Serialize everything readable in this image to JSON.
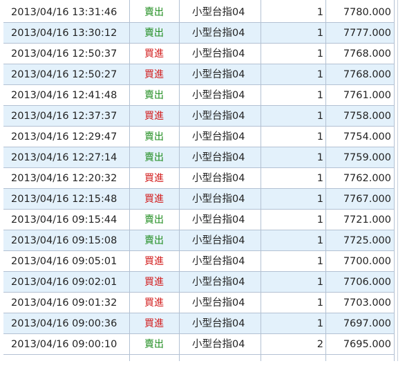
{
  "trades": [
    {
      "time": "2013/04/16 13:31:46",
      "side": "賣出",
      "side_type": "sell",
      "product": "小型台指04",
      "qty": "1",
      "price": "7780.000"
    },
    {
      "time": "2013/04/16 13:30:12",
      "side": "賣出",
      "side_type": "sell",
      "product": "小型台指04",
      "qty": "1",
      "price": "7777.000"
    },
    {
      "time": "2013/04/16 12:50:37",
      "side": "買進",
      "side_type": "buy",
      "product": "小型台指04",
      "qty": "1",
      "price": "7768.000"
    },
    {
      "time": "2013/04/16 12:50:27",
      "side": "買進",
      "side_type": "buy",
      "product": "小型台指04",
      "qty": "1",
      "price": "7768.000"
    },
    {
      "time": "2013/04/16 12:41:48",
      "side": "賣出",
      "side_type": "sell",
      "product": "小型台指04",
      "qty": "1",
      "price": "7761.000"
    },
    {
      "time": "2013/04/16 12:37:37",
      "side": "買進",
      "side_type": "buy",
      "product": "小型台指04",
      "qty": "1",
      "price": "7758.000"
    },
    {
      "time": "2013/04/16 12:29:47",
      "side": "賣出",
      "side_type": "sell",
      "product": "小型台指04",
      "qty": "1",
      "price": "7754.000"
    },
    {
      "time": "2013/04/16 12:27:14",
      "side": "賣出",
      "side_type": "sell",
      "product": "小型台指04",
      "qty": "1",
      "price": "7759.000"
    },
    {
      "time": "2013/04/16 12:20:32",
      "side": "買進",
      "side_type": "buy",
      "product": "小型台指04",
      "qty": "1",
      "price": "7762.000"
    },
    {
      "time": "2013/04/16 12:15:48",
      "side": "買進",
      "side_type": "buy",
      "product": "小型台指04",
      "qty": "1",
      "price": "7767.000"
    },
    {
      "time": "2013/04/16 09:15:44",
      "side": "賣出",
      "side_type": "sell",
      "product": "小型台指04",
      "qty": "1",
      "price": "7721.000"
    },
    {
      "time": "2013/04/16 09:15:08",
      "side": "賣出",
      "side_type": "sell",
      "product": "小型台指04",
      "qty": "1",
      "price": "7725.000"
    },
    {
      "time": "2013/04/16 09:05:01",
      "side": "買進",
      "side_type": "buy",
      "product": "小型台指04",
      "qty": "1",
      "price": "7700.000"
    },
    {
      "time": "2013/04/16 09:02:01",
      "side": "買進",
      "side_type": "buy",
      "product": "小型台指04",
      "qty": "1",
      "price": "7706.000"
    },
    {
      "time": "2013/04/16 09:01:32",
      "side": "買進",
      "side_type": "buy",
      "product": "小型台指04",
      "qty": "1",
      "price": "7703.000"
    },
    {
      "time": "2013/04/16 09:00:36",
      "side": "買進",
      "side_type": "buy",
      "product": "小型台指04",
      "qty": "1",
      "price": "7697.000"
    },
    {
      "time": "2013/04/16 09:00:10",
      "side": "賣出",
      "side_type": "sell",
      "product": "小型台指04",
      "qty": "2",
      "price": "7695.000"
    }
  ],
  "colors": {
    "sell_text": "#1e8c1e",
    "buy_text": "#d21c1c",
    "alt_row_bg": "#e3f1fb",
    "grid_line": "#b3c1d3"
  }
}
